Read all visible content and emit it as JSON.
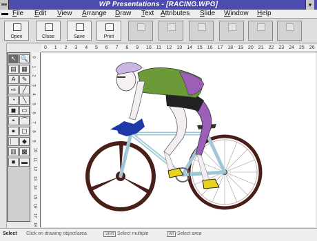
{
  "window": {
    "title": "WP Presentations - [RACING.WPG]",
    "title_bar_color": "#4b4bb0",
    "control_menu_icon": "dash-icon",
    "corner_button_icon": "minimize-icon"
  },
  "menu": [
    {
      "label": "File",
      "accel": "F",
      "rest": "ile"
    },
    {
      "label": "Edit",
      "accel": "E",
      "rest": "dit"
    },
    {
      "label": "View",
      "accel": "V",
      "rest": "iew"
    },
    {
      "label": "Arrange",
      "accel": "A",
      "rest": "rrange"
    },
    {
      "label": "Draw",
      "accel": "D",
      "rest": "raw"
    },
    {
      "label": "Text",
      "accel": "T",
      "rest": "ext"
    },
    {
      "label": "Attributes",
      "accel": "A",
      "rest": "ttributes"
    },
    {
      "label": "Slide",
      "accel": "S",
      "rest": "lide"
    },
    {
      "label": "Window",
      "accel": "W",
      "rest": "indow"
    },
    {
      "label": "Help",
      "accel": "H",
      "rest": "elp"
    }
  ],
  "toolbar": [
    {
      "label": "Open",
      "icon": "open-file-icon"
    },
    {
      "label": "Close",
      "icon": "close-file-icon"
    },
    {
      "label": "Save",
      "icon": "save-icon"
    },
    {
      "label": "Print",
      "icon": "print-icon"
    },
    {
      "label": "",
      "icon": "shape-icon"
    },
    {
      "label": "",
      "icon": "tool-icon"
    },
    {
      "label": "",
      "icon": "tool-icon"
    },
    {
      "label": "",
      "icon": "tool-icon"
    },
    {
      "label": "",
      "icon": "tool-icon"
    },
    {
      "label": "",
      "icon": "tool-icon"
    }
  ],
  "ruler": {
    "horizontal": [
      "0",
      "1",
      "2",
      "3",
      "4",
      "5",
      "6",
      "7",
      "8",
      "9",
      "10",
      "11",
      "12",
      "13",
      "14",
      "15",
      "16",
      "17",
      "18",
      "19",
      "20",
      "21",
      "22",
      "23",
      "24",
      "25",
      "26"
    ],
    "vertical": [
      "0",
      "1",
      "2",
      "3",
      "4",
      "5",
      "6",
      "7",
      "8",
      "9",
      "10",
      "11",
      "12",
      "13",
      "14",
      "15",
      "16",
      "17",
      "18"
    ]
  },
  "tools": [
    {
      "symbol": "↖",
      "icon": "pointer-icon",
      "selected": true
    },
    {
      "symbol": "🔍",
      "icon": "zoom-icon",
      "selected": false
    },
    {
      "symbol": "▤",
      "icon": "chart-icon",
      "selected": false
    },
    {
      "symbol": "▦",
      "icon": "figure-icon",
      "selected": false
    },
    {
      "symbol": "A",
      "icon": "text-icon",
      "selected": false
    },
    {
      "symbol": "✎",
      "icon": "pen-icon",
      "selected": false
    },
    {
      "symbol": "⇨",
      "icon": "arrow-icon",
      "selected": false
    },
    {
      "symbol": "╱",
      "icon": "line-icon",
      "selected": false
    },
    {
      "symbol": "◔",
      "icon": "curve-icon",
      "selected": false
    },
    {
      "symbol": "╲",
      "icon": "polyline-icon",
      "selected": false
    },
    {
      "symbol": "◼",
      "icon": "fill-icon",
      "selected": false
    },
    {
      "symbol": "▭",
      "icon": "rectangle-icon",
      "selected": false
    },
    {
      "symbol": "◓",
      "icon": "arc-icon",
      "selected": false
    },
    {
      "symbol": "⌒",
      "icon": "freehand-icon",
      "selected": false
    },
    {
      "symbol": "●",
      "icon": "circle-icon",
      "selected": false
    },
    {
      "symbol": "▢",
      "icon": "rounded-rect-icon",
      "selected": false
    },
    {
      "symbol": "⎸",
      "icon": "line-width-icon",
      "selected": false
    },
    {
      "symbol": "◆",
      "icon": "line-style-icon",
      "selected": false
    },
    {
      "symbol": "▥",
      "icon": "pattern-icon",
      "selected": false
    },
    {
      "symbol": "▩",
      "icon": "fill-pattern-icon",
      "selected": false
    },
    {
      "symbol": "■",
      "icon": "fill-color-icon",
      "selected": false
    },
    {
      "symbol": "▬",
      "icon": "line-color-icon",
      "selected": false
    }
  ],
  "illustration": {
    "subject": "racing cyclist on road bike",
    "colors": {
      "helmet": "#c9b8e6",
      "jersey_green": "#6c9a38",
      "jersey_purple": "#9b5fb8",
      "shorts": "#222222",
      "skin_shade": "#e8e0e8",
      "disc_wheel": "#4a1f1a",
      "rear_wheel_rim": "#4a1f1a",
      "frame": "#cfe6f0",
      "shoe_yellow": "#e8d21c",
      "splash_blue": "#1e3aa8"
    }
  },
  "status": {
    "mode": "Select",
    "hint1": "Click on drawing object/area",
    "key1": "Shift",
    "hint2": "Select multiple",
    "key2": "Alt",
    "hint3": "Select area"
  }
}
